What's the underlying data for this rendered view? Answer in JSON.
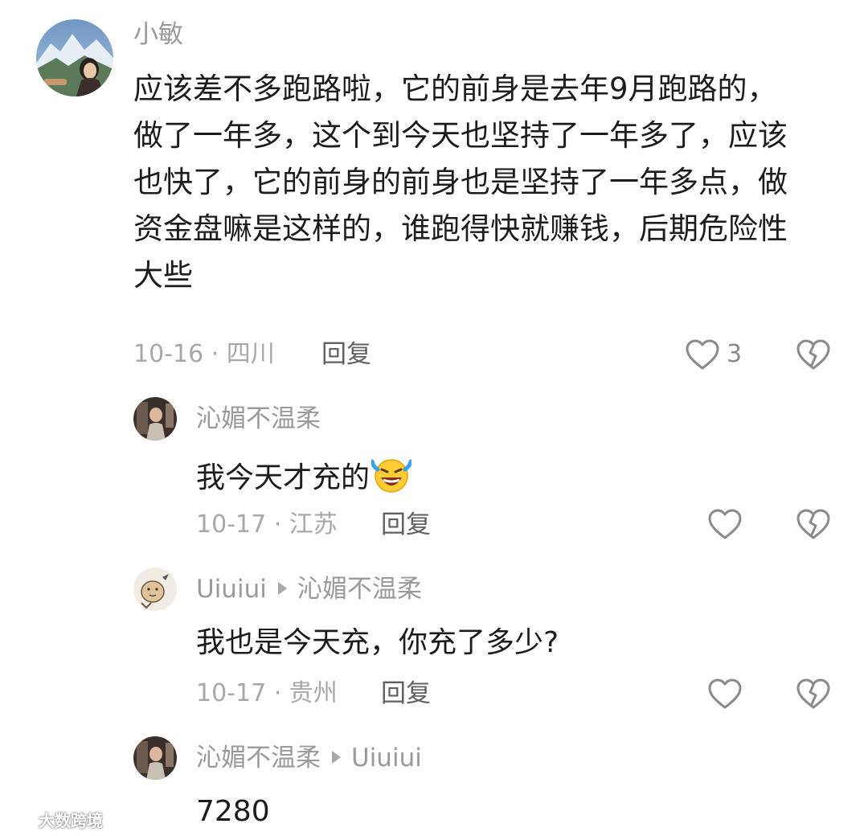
{
  "comments": [
    {
      "author": "小敏",
      "text": "应该差不多跑路啦，它的前身是去年9月跑路的，做了一年多，这个到今天也坚持了一年多了，应该也快了，它的前身的前身也是坚持了一年多点，做资金盘嘛是这样的，谁跑得快就赚钱，后期危险性大些",
      "date_location": "10-16 · 四川",
      "reply_label": "回复",
      "like_count": "3"
    },
    {
      "author": "沁媚不温柔",
      "text": "我今天才充的",
      "emoji": "laughing-crying-emoji",
      "date_location": "10-17 · 江苏",
      "reply_label": "回复"
    },
    {
      "author": "Uiuiui",
      "reply_to": "沁媚不温柔",
      "text": "我也是今天充，你充了多少?",
      "date_location": "10-17 · 贵州",
      "reply_label": "回复"
    },
    {
      "author": "沁媚不温柔",
      "reply_to": "Uiuiui",
      "text": "7280"
    }
  ],
  "watermark": "大数跨境",
  "colors": {
    "username": "#9a9a9a",
    "meta": "#a8a8a8",
    "reply": "#606060",
    "icon": "#8a8a8a",
    "text": "#1c1c1c"
  }
}
